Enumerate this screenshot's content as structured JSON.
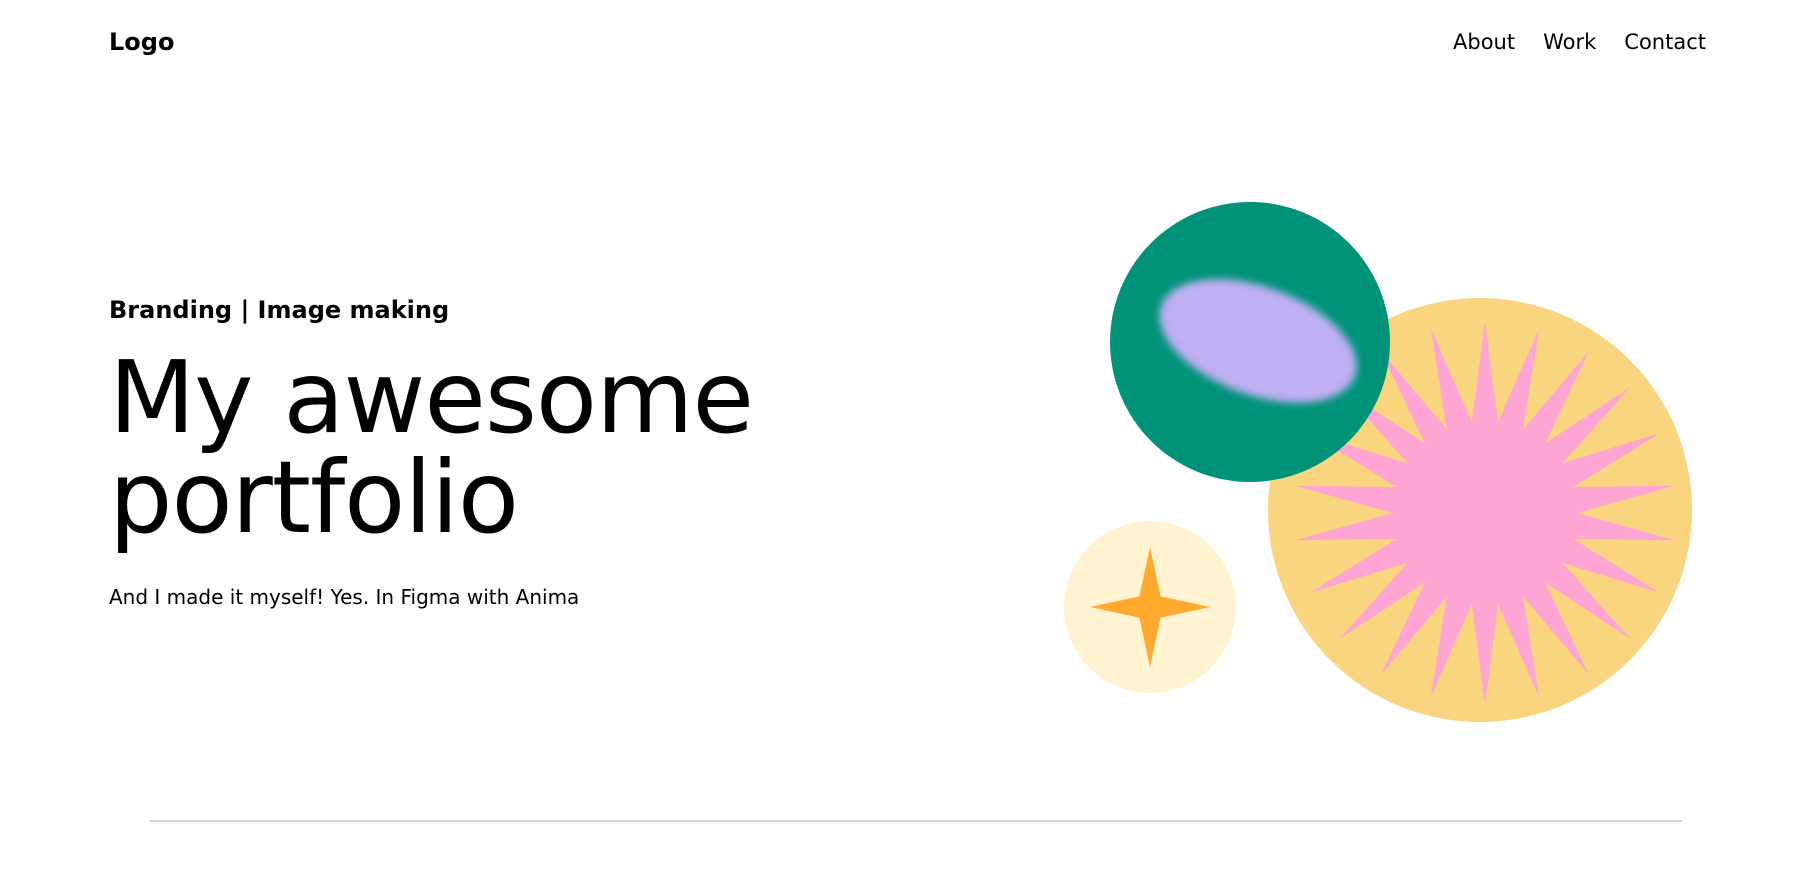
{
  "header": {
    "logo": "Logo",
    "nav": [
      {
        "label": "About"
      },
      {
        "label": "Work"
      },
      {
        "label": "Contact"
      }
    ]
  },
  "hero": {
    "eyebrow": "Branding | Image making",
    "headline_line1": "My awesome",
    "headline_line2": "portfolio",
    "subtitle": "And I made it myself! Yes. In Figma with Anima"
  },
  "art": {
    "colors": {
      "green_circle": "#009379",
      "lavender_blob": "#BFAFF3",
      "yellow_circle": "#F8D57E",
      "pink_starburst": "#FFA5D3",
      "cream_circle": "#FFF3D1",
      "orange_star": "#FFAA2E"
    },
    "shapes": [
      "green-circle",
      "lavender-blob",
      "yellow-circle",
      "pink-starburst",
      "cream-circle",
      "orange-star"
    ]
  },
  "footer": {
    "divider_color": "#D3D3D3"
  }
}
